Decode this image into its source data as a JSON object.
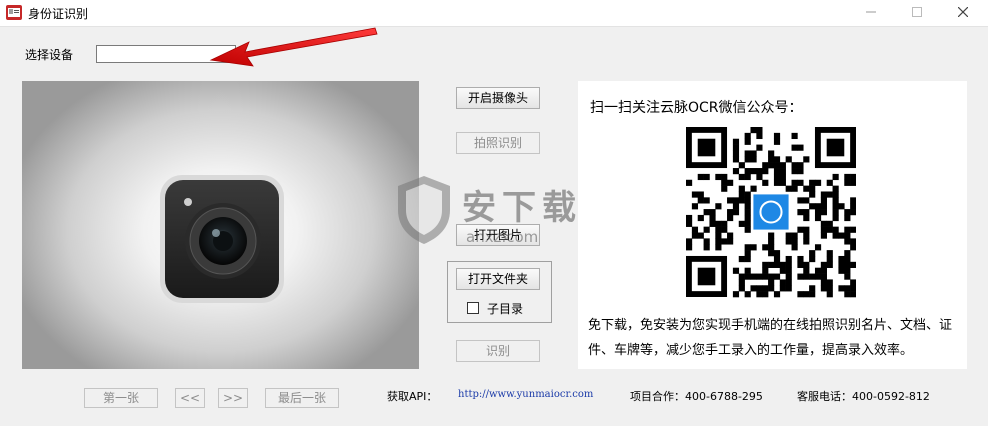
{
  "window": {
    "title": "身份证识别"
  },
  "device": {
    "label": "选择设备",
    "value": ""
  },
  "buttons": {
    "open_camera": "开启摄像头",
    "capture": "拍照识别",
    "open_image": "打开图片",
    "open_folder": "打开文件夹",
    "subdir": "子目录",
    "recognize": "识别"
  },
  "qr": {
    "title": "扫一扫关注云脉OCR微信公众号：",
    "description": "免下载，免安装为您实现手机端的在线拍照识别名片、文档、证件、车牌等，减少您手工录入的工作量，提高录入效率。"
  },
  "nav": {
    "first": "第一张",
    "prev": "<<",
    "next": ">>",
    "last": "最后一张"
  },
  "footer": {
    "api_label": "获取API：",
    "api_url": "http://www.yunmaiocr.com",
    "cooperation": "项目合作：400-6788-295",
    "service": "客服电话：400-0592-812"
  },
  "watermark": {
    "text": "安下载",
    "sub": "anxz.com"
  },
  "colors": {
    "arrow": "#e02020",
    "qr_center": "#1e88e5",
    "link": "#1a3aa8"
  }
}
